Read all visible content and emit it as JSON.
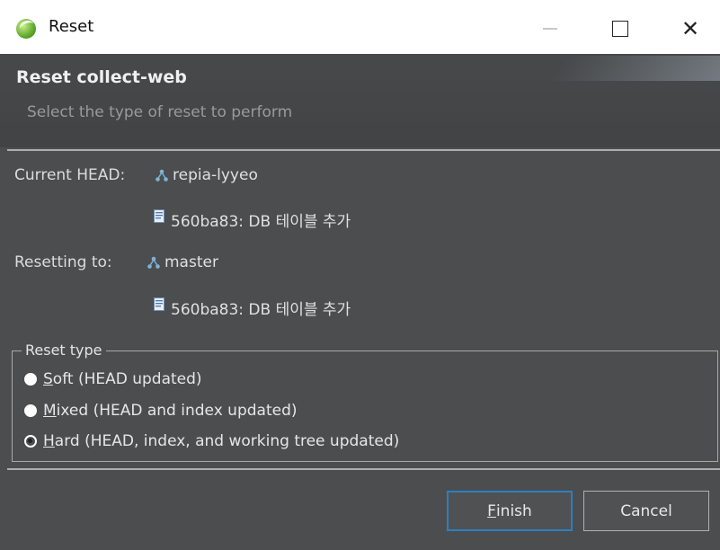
{
  "window": {
    "title": "Reset",
    "minimize_symbol": "—",
    "maximize_symbol": "☐",
    "close_symbol": "✕",
    "app_icon": "eclipse-icon"
  },
  "header": {
    "title": "Reset collect-web",
    "subtitle": "Select the type of reset to perform"
  },
  "current_head": {
    "label": "Current HEAD:",
    "branch": "repia-lyyeo",
    "commit": "560ba83:  DB 테이블 추가",
    "branch_icon": "branch-icon",
    "commit_icon": "commit-icon"
  },
  "resetting_to": {
    "label": "Resetting to:",
    "branch": "master",
    "commit": "560ba83:  DB 테이블 추가",
    "branch_icon": "branch-icon",
    "commit_icon": "commit-icon"
  },
  "reset_type": {
    "legend": "Reset type",
    "options": [
      {
        "mnemonic": "S",
        "rest": "oft (HEAD updated)",
        "selected": false
      },
      {
        "mnemonic": "M",
        "rest": "ixed (HEAD and index updated)",
        "selected": false
      },
      {
        "mnemonic": "H",
        "rest": "ard (HEAD, index, and working tree updated)",
        "selected": true
      }
    ]
  },
  "buttons": {
    "finish": {
      "mnemonic": "F",
      "rest": "inish"
    },
    "cancel": "Cancel"
  },
  "colors": {
    "dialog_bg": "#4b4d4f",
    "focus_border": "#2d7fc1",
    "branch_icon": "#7fb3d5"
  }
}
